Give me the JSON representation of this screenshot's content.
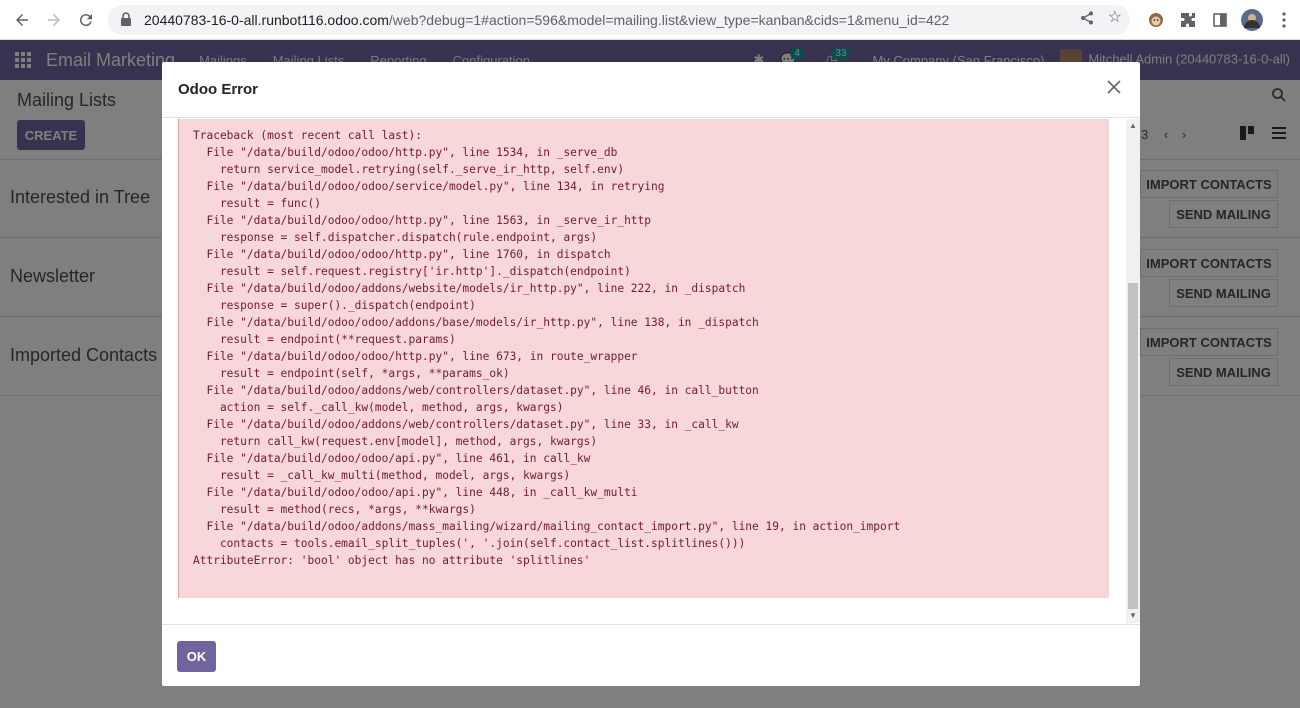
{
  "browser": {
    "url_host": "20440783-16-0-all.runbot116.odoo.com",
    "url_path": "/web?debug=1#action=596&model=mailing.list&view_type=kanban&cids=1&menu_id=422"
  },
  "odoo": {
    "app_name": "Email Marketing",
    "menus": [
      "Mailings",
      "Mailing Lists",
      "Reporting",
      "Configuration"
    ],
    "messages_count": "4",
    "activities_count": "33",
    "company": "My Company (San Francisco)",
    "user": "Mitchell Admin (20440783-16-0-all)",
    "breadcrumb": "Mailing Lists",
    "create_label": "CREATE",
    "pager": "3",
    "cards": [
      {
        "title": "Interested in Tree",
        "import": "IMPORT CONTACTS",
        "send": "SEND MAILING"
      },
      {
        "title": "Newsletter",
        "import": "IMPORT CONTACTS",
        "send": "SEND MAILING"
      },
      {
        "title": "Imported Contacts",
        "import": "IMPORT CONTACTS",
        "send": "SEND MAILING"
      }
    ]
  },
  "dialog": {
    "title": "Odoo Error",
    "traceback": "Traceback (most recent call last):\n  File \"/data/build/odoo/odoo/http.py\", line 1534, in _serve_db\n    return service_model.retrying(self._serve_ir_http, self.env)\n  File \"/data/build/odoo/odoo/service/model.py\", line 134, in retrying\n    result = func()\n  File \"/data/build/odoo/odoo/http.py\", line 1563, in _serve_ir_http\n    response = self.dispatcher.dispatch(rule.endpoint, args)\n  File \"/data/build/odoo/odoo/http.py\", line 1760, in dispatch\n    result = self.request.registry['ir.http']._dispatch(endpoint)\n  File \"/data/build/odoo/addons/website/models/ir_http.py\", line 222, in _dispatch\n    response = super()._dispatch(endpoint)\n  File \"/data/build/odoo/odoo/addons/base/models/ir_http.py\", line 138, in _dispatch\n    result = endpoint(**request.params)\n  File \"/data/build/odoo/odoo/http.py\", line 673, in route_wrapper\n    result = endpoint(self, *args, **params_ok)\n  File \"/data/build/odoo/addons/web/controllers/dataset.py\", line 46, in call_button\n    action = self._call_kw(model, method, args, kwargs)\n  File \"/data/build/odoo/addons/web/controllers/dataset.py\", line 33, in _call_kw\n    return call_kw(request.env[model], method, args, kwargs)\n  File \"/data/build/odoo/odoo/api.py\", line 461, in call_kw\n    result = _call_kw_multi(method, model, args, kwargs)\n  File \"/data/build/odoo/odoo/api.py\", line 448, in _call_kw_multi\n    result = method(recs, *args, **kwargs)\n  File \"/data/build/odoo/addons/mass_mailing/wizard/mailing_contact_import.py\", line 19, in action_import\n    contacts = tools.email_split_tuples(', '.join(self.contact_list.splitlines()))\nAttributeError: 'bool' object has no attribute 'splitlines'",
    "ok_label": "OK"
  },
  "colors": {
    "brand": "#71639e",
    "error_bg": "#f8d7da",
    "error_text": "#721c24"
  }
}
